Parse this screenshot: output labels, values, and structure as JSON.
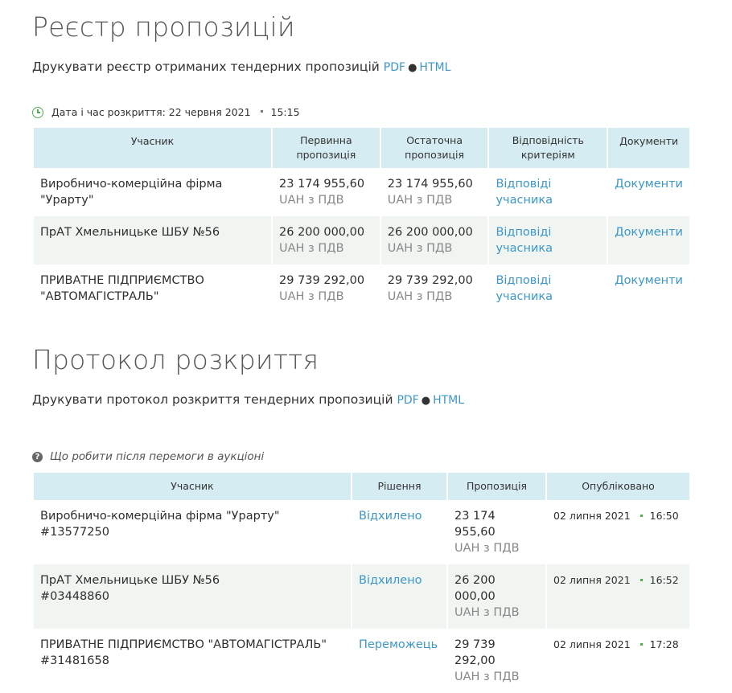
{
  "registry": {
    "title": "Реєстр пропозицій",
    "print_text": "Друкувати реєстр отриманих тендерних пропозицій",
    "pdf": "PDF",
    "dot": "●",
    "html": "HTML",
    "opening_label": "Дата і час розкриття: 22 червня 2021",
    "opening_time": "15:15",
    "headers": [
      "Учасник",
      "Первинна пропозиція",
      "Остаточна пропозиція",
      "Відповідність критеріям",
      "Документи"
    ],
    "rows": [
      {
        "participant": "Виробничо-комерційна фірма \"Урарту\"",
        "initial": "23 174 955,60",
        "initial_cur": "UAH з ПДВ",
        "final": "23 174 955,60",
        "final_cur": "UAH з ПДВ",
        "criteria": "Відповіді учасника",
        "docs": "Документи"
      },
      {
        "participant": "ПрАТ Хмельницьке ШБУ №56",
        "initial": "26 200 000,00",
        "initial_cur": "UAH з ПДВ",
        "final": "26 200 000,00",
        "final_cur": "UAH з ПДВ",
        "criteria": "Відповіді учасника",
        "docs": "Документи"
      },
      {
        "participant": "ПРИВАТНЕ ПІДПРИЄМСТВО \"АВТОМАГІСТРАЛЬ\"",
        "initial": "29 739 292,00",
        "initial_cur": "UAH з ПДВ",
        "final": "29 739 292,00",
        "final_cur": "UAH з ПДВ",
        "criteria": "Відповіді учасника",
        "docs": "Документи"
      }
    ]
  },
  "protocol": {
    "title": "Протокол розкриття",
    "print_text": "Друкувати протокол розкриття тендерних пропозицій",
    "pdf": "PDF",
    "dot": "●",
    "html": "HTML",
    "what_next": "Що робити після перемоги в аукціоні",
    "headers": [
      "Учасник",
      "Рішення",
      "Пропозиція",
      "Опубліковано"
    ],
    "rows": [
      {
        "participant": "Виробничо-комерційна фірма \"Урарту\"",
        "id": "#13577250",
        "decision": "Відхилено",
        "offer": "23 174 955,60",
        "offer_cur": "UAH з ПДВ",
        "date": "02 липня 2021",
        "time": "16:50"
      },
      {
        "participant": "ПрАТ Хмельницьке ШБУ №56",
        "id": "#03448860",
        "decision": "Відхилено",
        "offer": "26 200 000,00",
        "offer_cur": "UAH з ПДВ",
        "date": "02 липня 2021",
        "time": "16:52"
      },
      {
        "participant": "ПРИВАТНЕ ПІДПРИЄМСТВО \"АВТОМАГІСТРАЛЬ\"",
        "id": "#31481658",
        "decision": "Переможець",
        "offer": "29 739 292,00",
        "offer_cur": "UAH з ПДВ",
        "date": "02 липня 2021",
        "time": "17:28"
      }
    ]
  },
  "colors": {
    "accent_link": "#3c97c9",
    "header_bg": "#d6ecf3",
    "alt_row_bg": "#f0f5f2",
    "clock_green": "#4caf50"
  },
  "icons": {
    "opening": "clock-icon",
    "help": "question-circle-icon"
  }
}
